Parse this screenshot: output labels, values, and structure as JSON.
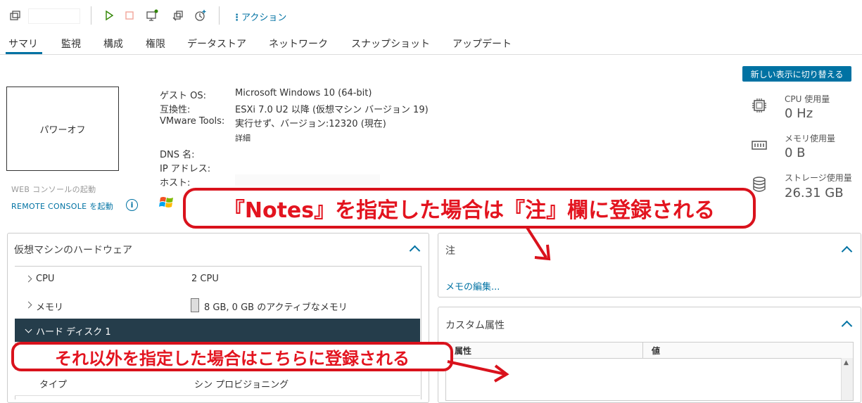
{
  "toolbar": {
    "action_label": "アクション",
    "icons": [
      "vm-icon",
      "power-on-icon",
      "power-off-icon",
      "console-icon",
      "migrate-icon",
      "snapshot-icon"
    ]
  },
  "tabs": [
    {
      "label": "サマリ",
      "active": true
    },
    {
      "label": "監視"
    },
    {
      "label": "構成"
    },
    {
      "label": "権限"
    },
    {
      "label": "データストア"
    },
    {
      "label": "ネットワーク"
    },
    {
      "label": "スナップショット"
    },
    {
      "label": "アップデート"
    }
  ],
  "switch_view_label": "新しい表示に切り替える",
  "thumbnail": {
    "status": "パワーオフ"
  },
  "console": {
    "web": "WEB コンソールの起動",
    "remote": "REMOTE CONSOLE を起動"
  },
  "info": {
    "guest_os_label": "ゲスト OS:",
    "guest_os": "Microsoft Windows 10 (64-bit)",
    "compat_label": "互換性:",
    "compat": "ESXi 7.0 U2 以降 (仮想マシン バージョン 19)",
    "tools_label": "VMware Tools:",
    "tools": "実行せず、バージョン:12320 (現在)",
    "details": "詳細",
    "dns_label": "DNS 名:",
    "ip_label": "IP アドレス:",
    "host_label": "ホスト:"
  },
  "metrics": [
    {
      "label": "CPU 使用量",
      "value": "0 Hz",
      "icon": "cpu-icon"
    },
    {
      "label": "メモリ使用量",
      "value": "0 B",
      "icon": "memory-icon"
    },
    {
      "label": "ストレージ使用量",
      "value": "26.31 GB",
      "icon": "storage-icon"
    }
  ],
  "hardware": {
    "title": "仮想マシンのハードウェア",
    "rows": [
      {
        "label": "CPU",
        "value": "2 CPU"
      },
      {
        "label": "メモリ",
        "value": "8 GB, 0 GB のアクティブなメモリ"
      },
      {
        "label": "ハード ディスク 1",
        "value": ""
      },
      {
        "label": "タイプ",
        "value": "シン プロビジョニング"
      }
    ]
  },
  "notes": {
    "title": "注",
    "edit_link": "メモの編集..."
  },
  "custom_attrs": {
    "title": "カスタム属性",
    "col_attr": "属性",
    "col_value": "値"
  },
  "annotations": {
    "top": "『Notes』を指定した場合は『注』欄に登録される",
    "bottom": "それ以外を指定した場合はこちらに登録される"
  },
  "colors": {
    "accent": "#0072a3",
    "annotation": "#e3141f",
    "dark_row": "#253d4b"
  }
}
